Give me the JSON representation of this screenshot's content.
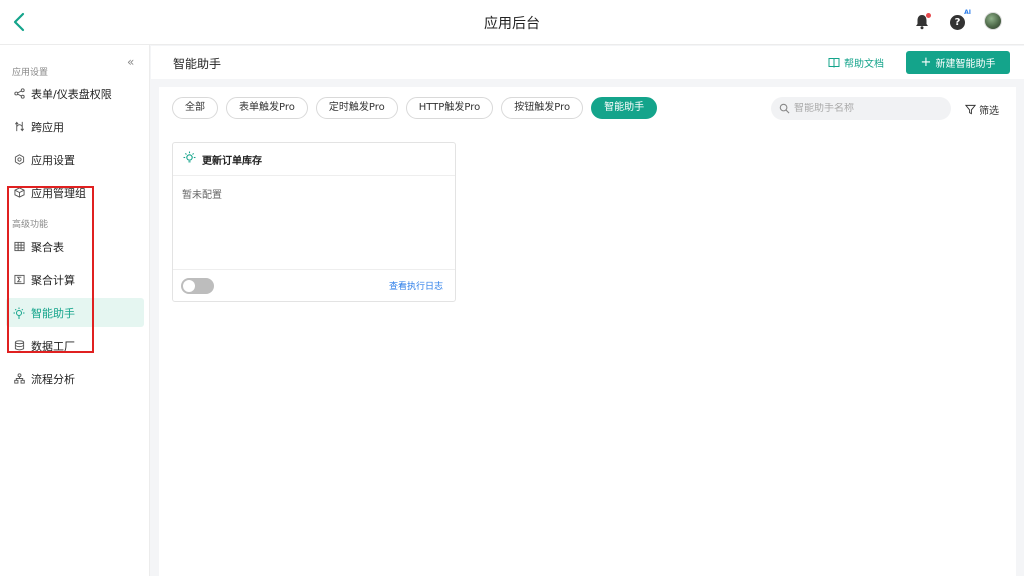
{
  "app": {
    "title": "应用后台"
  },
  "sidebar": {
    "section_app_settings": "应用设置",
    "section_advanced": "高级功能",
    "items": [
      {
        "label": "表单/仪表盘权限",
        "icon": "share-nodes-icon"
      },
      {
        "label": "跨应用",
        "icon": "cross-arrows-icon"
      },
      {
        "label": "应用设置",
        "icon": "gear-icon"
      },
      {
        "label": "应用管理组",
        "icon": "cube-icon"
      }
    ],
    "advanced_items": [
      {
        "label": "聚合表",
        "icon": "table-icon"
      },
      {
        "label": "聚合计算",
        "icon": "sigma-icon"
      },
      {
        "label": "智能助手",
        "icon": "lightbulb-icon",
        "active": true
      },
      {
        "label": "数据工厂",
        "icon": "database-icon"
      },
      {
        "label": "流程分析",
        "icon": "flow-icon"
      }
    ]
  },
  "header": {
    "title": "智能助手",
    "help_doc": "帮助文档",
    "new_button": "新建智能助手"
  },
  "filters": {
    "chips": [
      "全部",
      "表单触发Pro",
      "定时触发Pro",
      "HTTP触发Pro",
      "按钮触发Pro",
      "智能助手"
    ],
    "active_index": 5,
    "search_placeholder": "智能助手名称",
    "filter_label": "筛选"
  },
  "card": {
    "title": "更新订单库存",
    "body": "暂未配置",
    "enabled": false,
    "log_link": "查看执行日志"
  },
  "colors": {
    "accent": "#14a48b",
    "link": "#2b7de9",
    "highlight_box": "#e02020"
  }
}
